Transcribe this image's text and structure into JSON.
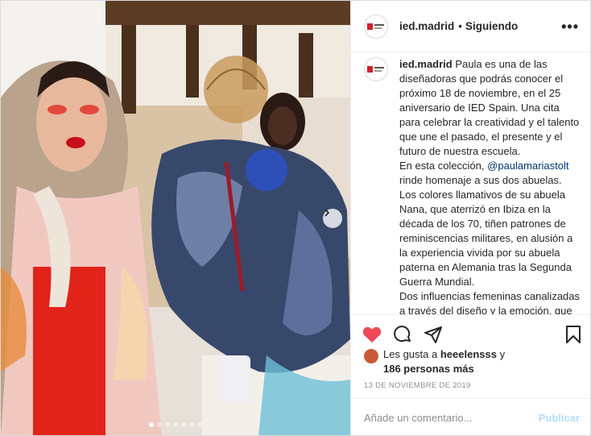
{
  "post": {
    "username": "ied.madrid",
    "separator": "•",
    "follow_label": "Siguiendo",
    "more_label": "•••"
  },
  "caption": {
    "username": "ied.madrid",
    "text_1": "Paula es una de las diseñadoras que podrás conocer el próximo 18 de noviembre, en el 25 aniversario de IED Spain. Una cita para celebrar la creatividad y el talento que une el pasado, el presente y el futuro de nuestra escuela.",
    "text_2_before": "En esta colección,",
    "mention": "@paulamariastolt",
    "text_2_after": "rinde homenaje a sus dos abuelas. Los colores llamativos de su abuela Nana, que aterrizó en Ibiza en la década de los 70, tiñen patrones de reminiscencias militares, en alusión a la experiencia vivida por su abuela paterna en Alemania tras la Segunda Guerra Mundial.",
    "text_3": "Dos influencias femeninas canalizadas a través del diseño y la emoción, que resultan en un sello tan propio y personal como distintivo."
  },
  "actions": {
    "like_icon": "heart-filled-icon",
    "comment_icon": "comment-bubble-icon",
    "share_icon": "paper-plane-icon",
    "save_icon": "bookmark-icon",
    "like_color": "#ed4956"
  },
  "likes": {
    "prefix": "Les gusta a",
    "user": "heeelensss",
    "conjunction": "y",
    "others": "186 personas más"
  },
  "date": "13 DE NOVIEMBRE DE 2019",
  "comment": {
    "placeholder": "Añade un comentario...",
    "publish_label": "Publicar"
  },
  "carousel": {
    "total_slides": 7,
    "active_slide": 1
  },
  "colors": {
    "link": "#00376b",
    "muted": "#8e8e8e",
    "publish_disabled": "#b2dffc",
    "border": "#dbdbdb"
  }
}
